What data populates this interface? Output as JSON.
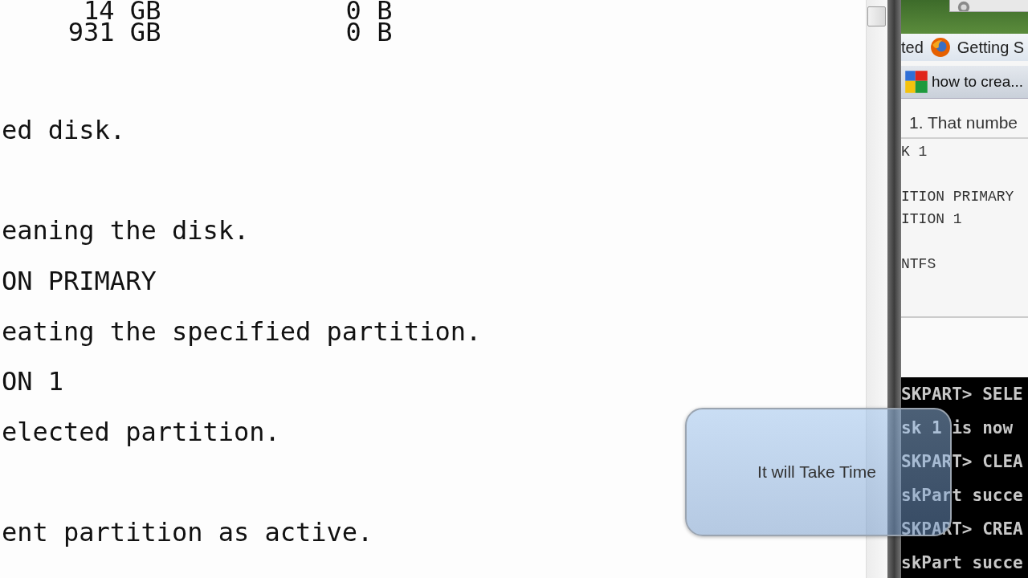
{
  "document": {
    "table_rows": [
      {
        "size": "14 GB",
        "free": "0 B"
      },
      {
        "size": "931 GB",
        "free": "0 B"
      }
    ],
    "lines": [
      "ed disk.",
      "eaning the disk.",
      "ON PRIMARY",
      "eating the specified partition.",
      "ON 1",
      "elected partition.",
      "ent partition as active."
    ]
  },
  "browser": {
    "thumbnail_items": [
      {
        "label": "ted",
        "kind": "text"
      },
      {
        "label": "Getting S",
        "kind": "firefox"
      }
    ],
    "hover_item": {
      "label": "how to crea...",
      "kind": "google"
    },
    "article_text": "1. That numbe",
    "code_lines": [
      "K 1",
      "ITION PRIMARY",
      "ITION 1",
      "NTFS"
    ],
    "console_lines": [
      "SKPART> SELE",
      "sk 1 is now",
      "SKPART> CLEA",
      "skPart succe",
      "SKPART> CREA",
      "skPart succe"
    ]
  },
  "tooltip": {
    "text": "It will Take Time"
  }
}
